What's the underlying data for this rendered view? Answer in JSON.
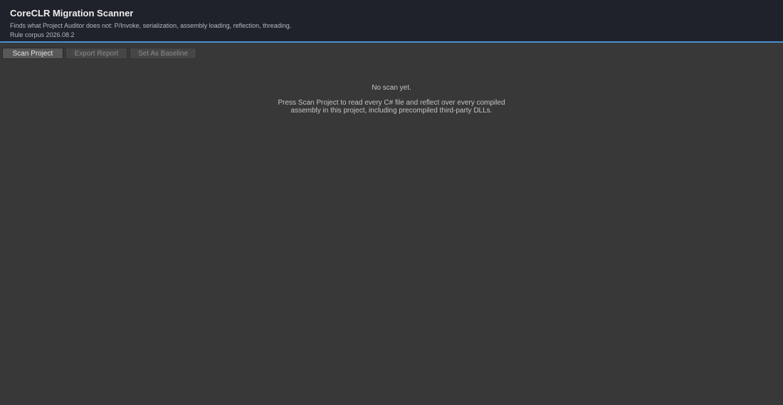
{
  "header": {
    "title": "CoreCLR Migration Scanner",
    "subtitle": "Finds what Project Auditor does not: P/Invoke, serialization, assembly loading, reflection, threading.",
    "version": "Rule corpus 2026.08.2"
  },
  "toolbar": {
    "scan_label": "Scan Project",
    "export_label": "Export Report",
    "baseline_label": "Set As Baseline"
  },
  "empty_state": {
    "title": "No scan yet.",
    "line1": "Press Scan Project to read every C# file and reflect over every compiled",
    "line2": "assembly in this project, including precompiled third-party DLLs."
  },
  "colors": {
    "header_background": "#1f222a",
    "accent": "#4b8fd6",
    "panel_background": "#383838"
  }
}
